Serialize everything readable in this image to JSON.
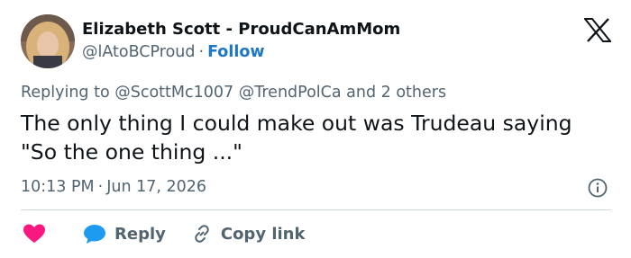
{
  "author": {
    "display_name": "Elizabeth Scott - ProudCanAmMom",
    "handle": "@lAtoBCProud",
    "separator": "·",
    "follow_label": "Follow"
  },
  "reply_context": {
    "prefix": "Replying to",
    "mentions": [
      "@ScottMc1007",
      "@TrendPolCa"
    ],
    "suffix": "and 2 others"
  },
  "tweet": {
    "text": "The only thing I could make out was Trudeau saying \"So the one thing ...\""
  },
  "meta": {
    "time": "10:13 PM",
    "separator": "·",
    "date": "Jun 17, 2026"
  },
  "actions": {
    "reply_label": "Reply",
    "copy_link_label": "Copy link"
  },
  "icons": {
    "like": "heart-icon",
    "reply": "speech-bubble-icon",
    "copy_link": "link-icon",
    "info": "info-icon",
    "logo": "x-logo-icon"
  },
  "colors": {
    "like": "#f91880",
    "reply": "#1d9bf0",
    "follow": "#1d77c9",
    "secondary_text": "#536471",
    "primary_text": "#0f1419",
    "divider": "#cfd9de"
  }
}
